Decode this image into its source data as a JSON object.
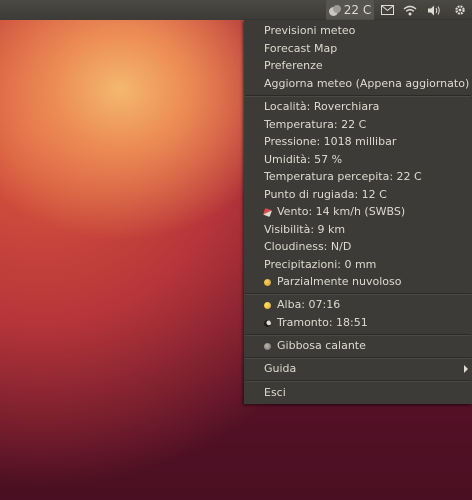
{
  "panel": {
    "weather_temp": "22 C"
  },
  "menu": {
    "actions": [
      "Previsioni meteo",
      "Forecast Map",
      "Preferenze",
      "Aggiorna meteo (Appena aggiornato)"
    ],
    "details": [
      "Località: Roverchiara",
      "Temperatura: 22 C",
      "Pressione: 1018 millibar",
      "Umidità: 57 %",
      "Temperatura percepita: 22 C",
      "Punto di rugiada: 12 C",
      "Vento: 14 km/h (SWBS)",
      "Visibilità: 9 km",
      "Cloudiness: N/D",
      "Precipitazioni: 0 mm",
      "Parzialmente nuvoloso"
    ],
    "sun": [
      "Alba: 07:16",
      "Tramonto: 18:51"
    ],
    "moon": "Gibbosa calante",
    "help": "Guida",
    "quit": "Esci"
  },
  "colors": {
    "panel_bg": "#3c3b37",
    "menu_text": "#dfdbd2",
    "active_indicator": "#57554f"
  }
}
